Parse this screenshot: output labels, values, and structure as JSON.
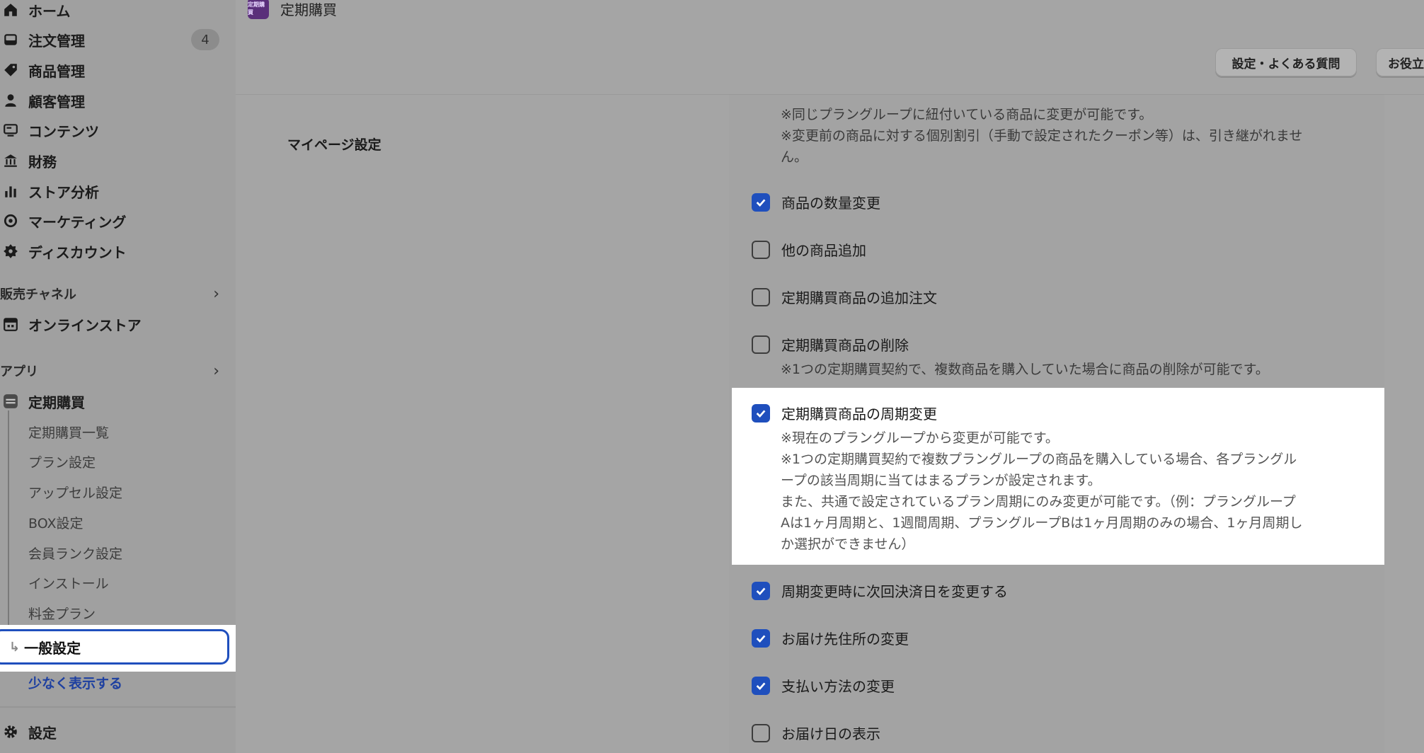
{
  "sidebar": {
    "items": [
      {
        "label": "ホーム",
        "icon": "home-icon"
      },
      {
        "label": "注文管理",
        "icon": "inbox-icon",
        "badge": "4"
      },
      {
        "label": "商品管理",
        "icon": "tag-icon"
      },
      {
        "label": "顧客管理",
        "icon": "person-icon"
      },
      {
        "label": "コンテンツ",
        "icon": "content-icon"
      },
      {
        "label": "財務",
        "icon": "bank-icon"
      },
      {
        "label": "ストア分析",
        "icon": "chart-icon"
      },
      {
        "label": "マーケティング",
        "icon": "target-icon"
      },
      {
        "label": "ディスカウント",
        "icon": "discount-icon"
      }
    ],
    "sales_channels_heading": "販売チャネル",
    "online_store": "オンラインストア",
    "apps_heading": "アプリ",
    "app_name": "定期購買",
    "app_subitems": [
      "定期購買一覧",
      "プラン設定",
      "アップセル設定",
      "BOX設定",
      "会員ランク設定",
      "インストール",
      "料金プラン"
    ],
    "active_item": "一般設定",
    "show_less": "少なく表示する",
    "settings": "設定"
  },
  "header": {
    "app_title": "定期購買",
    "logo_text": "定期購買"
  },
  "actions": {
    "faq_button": "設定・よくある質問",
    "help_button": "お役立"
  },
  "main": {
    "section_label": "マイページ設定",
    "top_notes": [
      "※同じプラングループに紐付いている商品に変更が可能です。",
      "※変更前の商品に対する個別割引（手動で設定されたクーポン等）は、引き継がれませ",
      "ん。"
    ],
    "options": [
      {
        "label": "商品の数量変更",
        "checked": true
      },
      {
        "label": "他の商品追加",
        "checked": false
      },
      {
        "label": "定期購買商品の追加注文",
        "checked": false
      },
      {
        "label": "定期購買商品の削除",
        "checked": false,
        "note": "※1つの定期購買契約で、複数商品を購入していた場合に商品の削除が可能です。"
      },
      {
        "label": "定期購買商品の周期変更",
        "checked": true,
        "notes": [
          "※現在のプラングループから変更が可能です。",
          "※1つの定期購買契約で複数プラングループの商品を購入している場合、各プラングル",
          "ープの該当周期に当てはまるプランが設定されます。",
          "また、共通で設定されているプラン周期にのみ変更が可能です。（例：プラングループ",
          "Aは1ヶ月周期と、1週間周期、プラングループBは1ヶ月周期のみの場合、1ヶ月周期し",
          "か選択ができません）"
        ]
      },
      {
        "label": "周期変更時に次回決済日を変更する",
        "checked": true
      },
      {
        "label": "お届け先住所の変更",
        "checked": true
      },
      {
        "label": "支払い方法の変更",
        "checked": true
      },
      {
        "label": "お届け日の表示",
        "checked": false
      }
    ]
  },
  "colors": {
    "accent": "#1f4fbd",
    "overlay": "#a5a5a5",
    "highlight": "#ffffff"
  }
}
